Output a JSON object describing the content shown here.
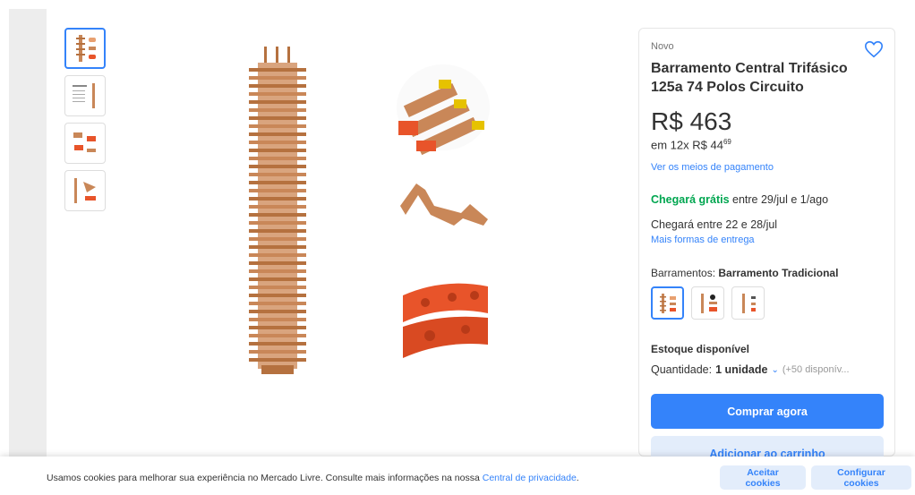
{
  "product": {
    "condition": "Novo",
    "title": "Barramento Central Trifásico 125a 74 Polos Circuito",
    "price": "R$ 463",
    "installments_prefix": "em 12x R$ 44",
    "installments_cents": "69",
    "payment_link": "Ver os meios de pagamento"
  },
  "shipping": {
    "free_label": "Chegará grátis",
    "free_dates": " entre 29/jul e 1/ago",
    "alt_text": "Chegará entre 22 e 28/jul",
    "alt_link": "Mais formas de entrega"
  },
  "variants": {
    "label": "Barramentos: ",
    "selected_name": "Barramento Tradicional"
  },
  "stock": {
    "label": "Estoque disponível",
    "qty_label": "Quantidade: ",
    "qty_value": "1 unidade",
    "available": "(+50 disponív..."
  },
  "actions": {
    "buy_now": "Comprar agora",
    "add_to_cart": "Adicionar ao carrinho"
  },
  "cookies": {
    "text": "Usamos cookies para melhorar sua experiência no Mercado Livre. Consulte mais informações na nossa ",
    "link": "Central de privacidade",
    "period": ".",
    "accept": "Aceitar cookies",
    "configure": "Configurar cookies"
  },
  "colors": {
    "accent": "#3483fa",
    "green": "#00a650",
    "copper": "#c98758",
    "orange": "#e8542a"
  },
  "icons": {
    "favorite": "heart-icon",
    "quantity": "chevron-down-icon"
  }
}
